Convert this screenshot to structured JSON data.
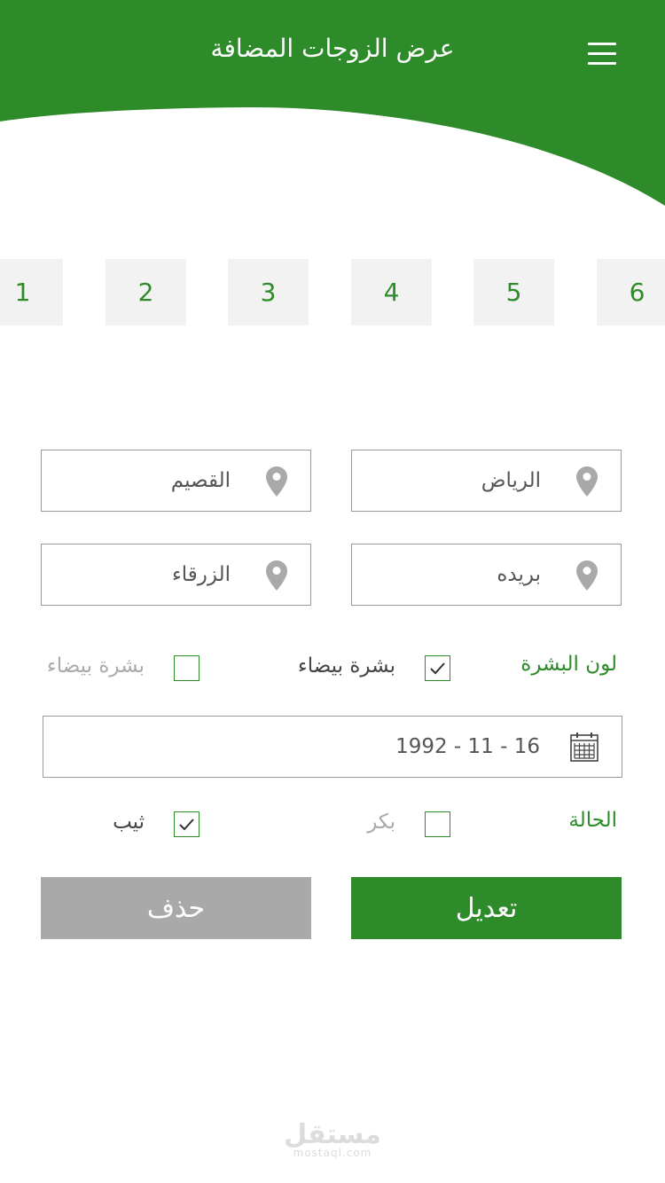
{
  "header": {
    "title": "عرض الزوجات المضافة"
  },
  "tabs": [
    "6",
    "5",
    "4",
    "3",
    "2",
    "1"
  ],
  "locations": {
    "right_top": "الرياض",
    "left_top": "القصيم",
    "right_bottom": "بريده",
    "left_bottom": "الزرقاء"
  },
  "skin": {
    "label": "لون البشرة",
    "option_1": "بشرة بيضاء",
    "option_2": "بشرة بيضاء"
  },
  "date": {
    "value": "1992 - 11 - 16"
  },
  "status": {
    "label": "الحالة",
    "option_1": "بكر",
    "option_2": "ثيب"
  },
  "buttons": {
    "edit": "تعديل",
    "delete": "حذف"
  },
  "watermark": {
    "main": "مستقل",
    "sub": "mostaql.com"
  },
  "colors": {
    "primary": "#2e8b2a",
    "muted": "#a9a9a9"
  },
  "icons": [
    "menu-icon",
    "location-pin-icon",
    "calendar-icon",
    "checkmark-icon"
  ]
}
